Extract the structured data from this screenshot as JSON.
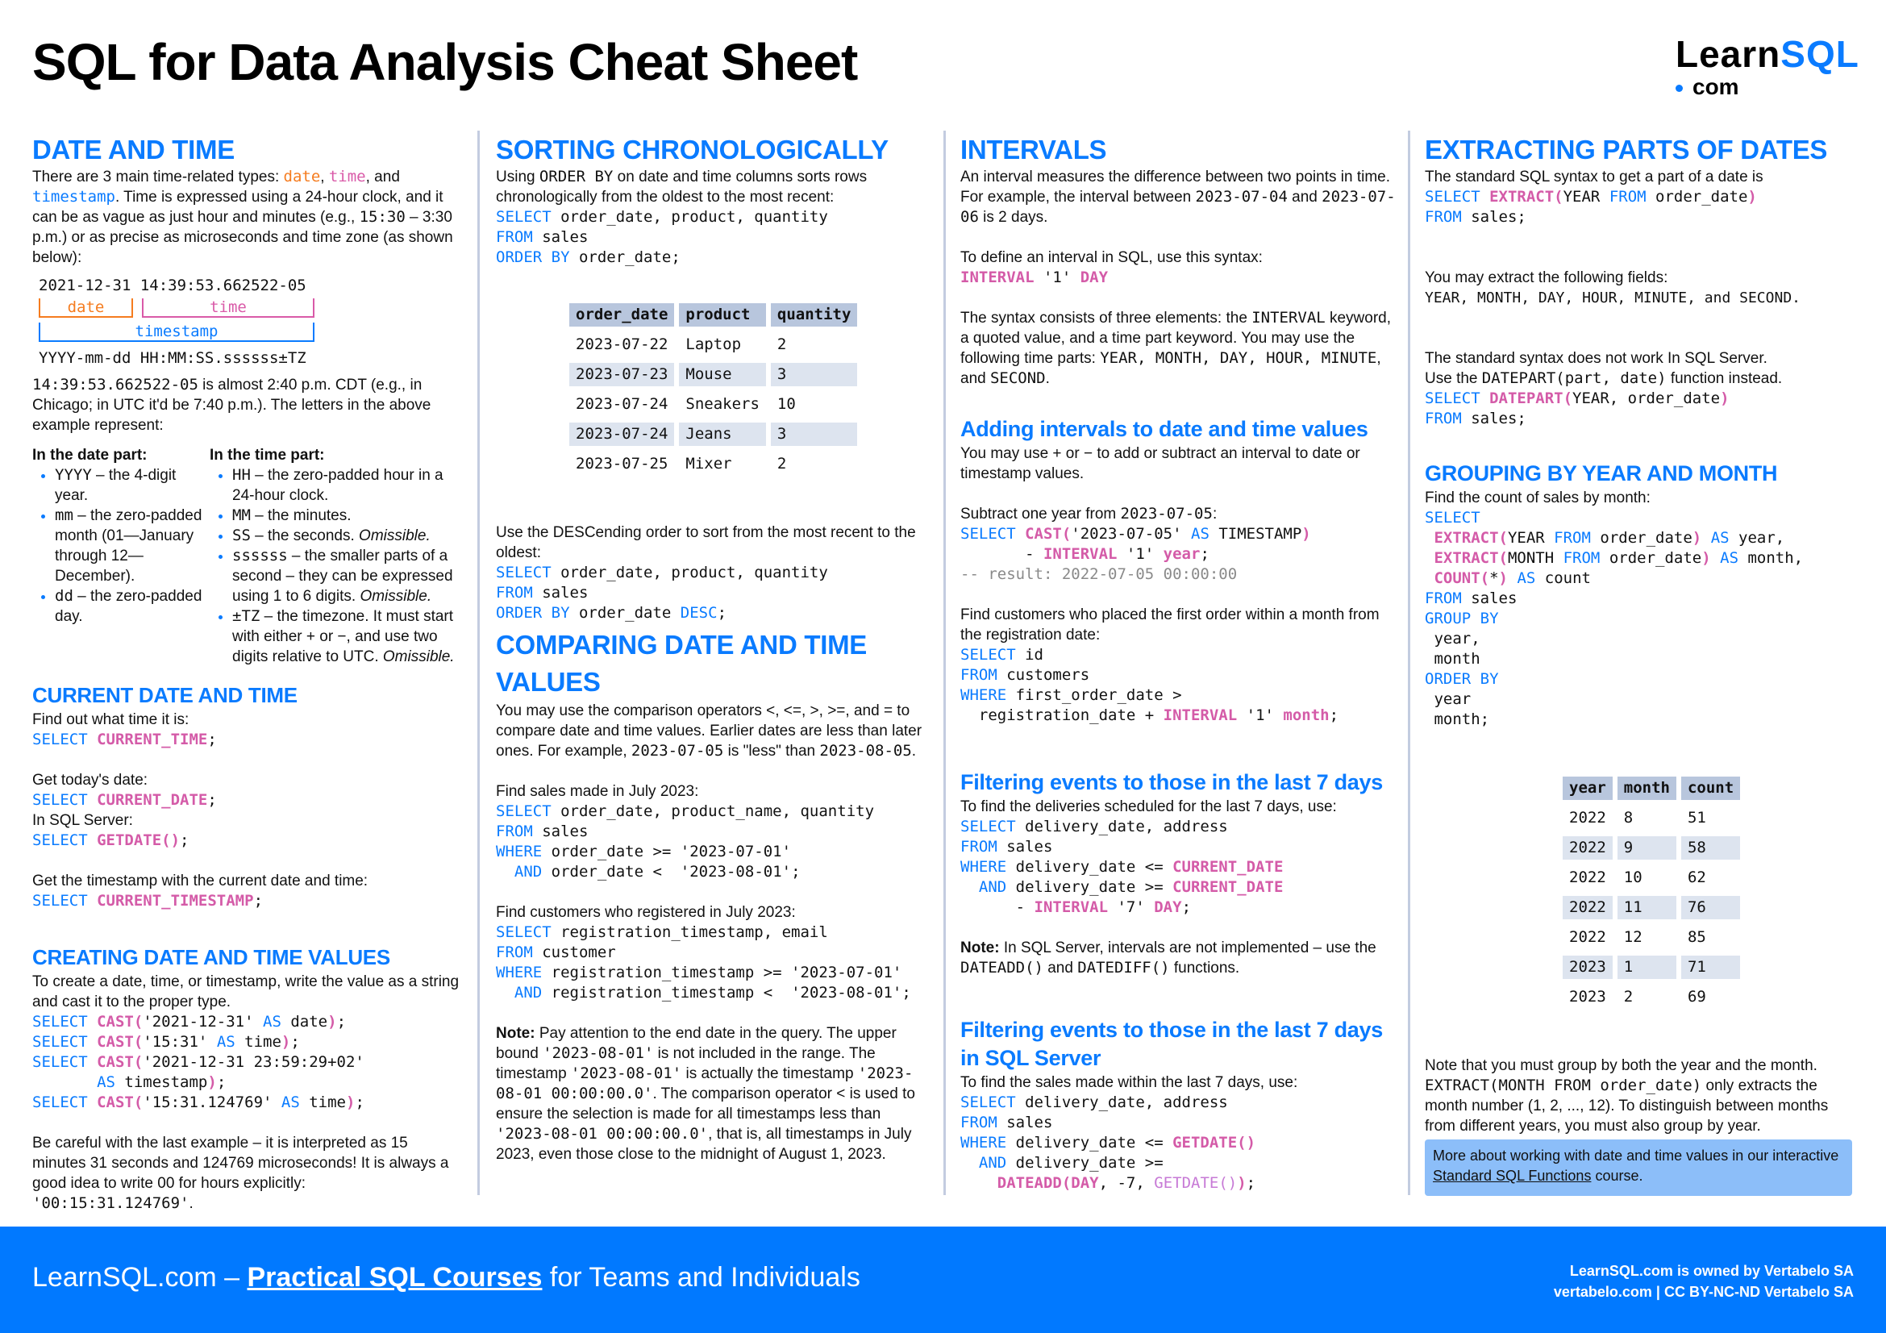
{
  "title": "SQL for Data Analysis Cheat Sheet",
  "logo": {
    "learn": "Learn",
    "sql": "SQL",
    "com": "com"
  },
  "colors": {
    "accent": "#0a7bff",
    "function": "#d45ba8",
    "date": "#f57c1f",
    "footer_bg": "#0179ff",
    "info_bg": "#8cbef9"
  },
  "col1": {
    "date_time": {
      "heading": "DATE AND TIME",
      "intro_1": "There are 3 main time-related types: ",
      "type_date": "date",
      "sep1": ", ",
      "type_time": "time",
      "sep2": ", and",
      "type_timestamp": "timestamp",
      "intro_2": ". Time is expressed using a 24-hour clock, and it can be as vague as just hour and minutes (e.g., ",
      "intro_code": "15:30",
      "intro_3": " – 3:30 p.m.) or as precise as microseconds and time zone (as shown below):",
      "diagram": {
        "example": "2021-12-31 14:39:53.662522-05",
        "label_date": "date",
        "label_time": "time",
        "label_timestamp": "timestamp",
        "format": "YYYY-mm-dd HH:MM:SS.ssssss±TZ"
      },
      "explain_code": "14:39:53.662522-05",
      "explain_text": " is almost 2:40 p.m. CDT (e.g., in Chicago; in UTC it'd be 7:40 p.m.). The letters in the above example represent:",
      "date_part_title": "In the date part:",
      "date_part_items": [
        {
          "code": "YYYY",
          "text": " – the 4-digit year."
        },
        {
          "code": "mm",
          "text": " – the zero-padded month (01—January through 12—December)."
        },
        {
          "code": "dd",
          "text": " – the zero-padded day."
        }
      ],
      "time_part_title": "In the time part:",
      "time_part_items": [
        {
          "code": "HH",
          "text": " – the zero-padded hour in a 24-hour clock.",
          "em": ""
        },
        {
          "code": "MM",
          "text": " – the minutes.",
          "em": ""
        },
        {
          "code": "SS",
          "text": " – the seconds. ",
          "em": "Omissible."
        },
        {
          "code": "ssssss",
          "text": " – the smaller parts of a second – they can be expressed using 1 to 6 digits. ",
          "em": "Omissible."
        },
        {
          "code": "±TZ",
          "text": " – the timezone. It must start with either + or −, and use two digits relative to UTC. ",
          "em": "Omissible."
        }
      ]
    },
    "current": {
      "heading": "CURRENT DATE AND TIME",
      "t1": "Find out what time it is:",
      "q1_kw": "SELECT",
      "q1_fn": "CURRENT_TIME",
      "q1_end": ";",
      "t2": "Get today's date:",
      "q2_kw": "SELECT",
      "q2_fn": "CURRENT_DATE",
      "q2_end": ";",
      "t3": "In SQL Server:",
      "q3_kw": "SELECT",
      "q3_fn": "GETDATE()",
      "q3_end": ";",
      "t4": "Get the timestamp with the current date and time:",
      "q4_kw": "SELECT",
      "q4_fn": "CURRENT_TIMESTAMP",
      "q4_end": ";"
    },
    "creating": {
      "heading": "CREATING DATE AND TIME VALUES",
      "intro": "To create a date, time, or timestamp, write the value as a string and cast it to the proper type.",
      "warning_1": "Be careful with the last example – it is interpreted as 15 minutes 31 seconds and 124769 microseconds! It is always a good idea to write 00 for hours explicitly: ",
      "warning_code": "'00:15:31.124769'",
      "warning_end": "."
    }
  },
  "col2": {
    "sorting": {
      "heading": "SORTING CHRONOLOGICALLY",
      "intro_1": "Using ",
      "intro_code": "ORDER BY",
      "intro_2": " on date and time columns sorts rows chronologically from the oldest to the most recent:",
      "table_headers": [
        "order_date",
        "product",
        "quantity"
      ],
      "table_rows": [
        [
          "2023-07-22",
          "Laptop",
          "2"
        ],
        [
          "2023-07-23",
          "Mouse",
          "3"
        ],
        [
          "2023-07-24",
          "Sneakers",
          "10"
        ],
        [
          "2023-07-24",
          "Jeans",
          "3"
        ],
        [
          "2023-07-25",
          "Mixer",
          "2"
        ]
      ],
      "desc_intro": "Use the DESCending order to sort from the most recent to the oldest:"
    },
    "comparing": {
      "heading": "COMPARING DATE AND TIME VALUES",
      "intro_1": "You may use the comparison operators <, <=, >, >=, and = to compare date and time values. Earlier dates are less than later ones. For example, ",
      "intro_code1": "2023-07-05",
      "intro_2": " is \"less\" than ",
      "intro_code2": "2023-08-05",
      "intro_3": ".",
      "t1": "Find sales made in July 2023:",
      "t2": "Find customers who registered in July 2023:",
      "note_label": "Note:",
      "note_1": " Pay attention to the end date in the query. The upper bound ",
      "note_code1": "'2023-08-01'",
      "note_2": " is not included in the range. The timestamp ",
      "note_code2": "'2023-08-01'",
      "note_3": " is actually the timestamp ",
      "note_code3": "'2023-08-01 00:00:00.0'",
      "note_4": ". The comparison operator < is used to ensure the selection is made for all timestamps less than ",
      "note_code4": "'2023-08-01 00:00:00.0'",
      "note_5": ", that is, all timestamps in July 2023, even those close to the midnight of August 1, 2023."
    }
  },
  "col3": {
    "intervals": {
      "heading": "INTERVALS",
      "intro_1": "An interval measures the difference between two points in time. For example, the interval between ",
      "intro_code1": "2023-07-04",
      "intro_2": " and ",
      "intro_code2": "2023-07-06",
      "intro_3": " is 2 days.",
      "syntax_intro": "To define an interval in SQL, use this syntax:",
      "syntax_fn": "INTERVAL",
      "syntax_val": " '1' ",
      "syntax_part": "DAY",
      "elements_1": "The syntax consists of three elements: the ",
      "elements_code": "INTERVAL",
      "elements_2": " keyword, a quoted value, and a time part keyword. You may use the following time parts: ",
      "elements_parts": "YEAR, MONTH, DAY, HOUR, MINUTE",
      "elements_3": ", and ",
      "elements_last": "SECOND",
      "elements_4": "."
    },
    "adding": {
      "heading": "Adding intervals to date and time values",
      "intro": "You may use + or − to add or subtract an interval to date or timestamp values.",
      "t1_text": "Subtract one year from ",
      "t1_code": "2023-07-05",
      "t1_end": ":",
      "result_comment": "-- result: 2022-07-05 00:00:00",
      "t2": "Find customers who placed the first order within a month from the registration date:"
    },
    "filtering": {
      "heading": "Filtering events to those in the last 7 days",
      "intro": "To find the deliveries scheduled for the last 7 days, use:",
      "note_label": "Note:",
      "note_1": " In SQL Server, intervals are not implemented – use the ",
      "note_code1": "DATEADD()",
      "note_2": " and ",
      "note_code2": "DATEDIFF()",
      "note_3": " functions."
    },
    "filtering_ss": {
      "heading": "Filtering events to those in the last 7 days in SQL Server",
      "intro": "To find the sales made within the last 7 days, use:"
    }
  },
  "col4": {
    "extracting": {
      "heading": "EXTRACTING PARTS OF DATES",
      "intro": "The standard SQL syntax to get a part of a date is",
      "fields_intro": "You may extract the following fields:",
      "fields_list": "YEAR, MONTH, DAY, HOUR, MINUTE, and SECOND.",
      "ss_1": "The standard syntax does not work In SQL Server.",
      "ss_2a": "Use the ",
      "ss_2code": "DATEPART(part, date)",
      "ss_2b": " function instead."
    },
    "grouping": {
      "heading": "GROUPING BY YEAR AND MONTH",
      "intro": "Find the count of sales by month:",
      "table_headers": [
        "year",
        "month",
        "count"
      ],
      "table_rows": [
        [
          "2022",
          "8",
          "51"
        ],
        [
          "2022",
          "9",
          "58"
        ],
        [
          "2022",
          "10",
          "62"
        ],
        [
          "2022",
          "11",
          "76"
        ],
        [
          "2022",
          "12",
          "85"
        ],
        [
          "2023",
          "1",
          "71"
        ],
        [
          "2023",
          "2",
          "69"
        ]
      ],
      "note_1": "Note that you must group by both the year and the month. ",
      "note_code": "EXTRACT(MONTH FROM order_date)",
      "note_2": " only extracts the month number (1, 2, ..., 12). To distinguish between months from different years, you must also group by year."
    },
    "info": {
      "text_1": "More about working with date and time values in our interactive ",
      "link": "Standard SQL Functions",
      "text_2": " course."
    }
  },
  "footer": {
    "left_1": "LearnSQL.com – ",
    "left_link": "Practical SQL Courses",
    "left_2": " for Teams and Individuals",
    "right_1": "LearnSQL.com is owned by Vertabelo SA",
    "right_2": "vertabelo.com | CC BY-NC-ND Vertabelo SA"
  }
}
